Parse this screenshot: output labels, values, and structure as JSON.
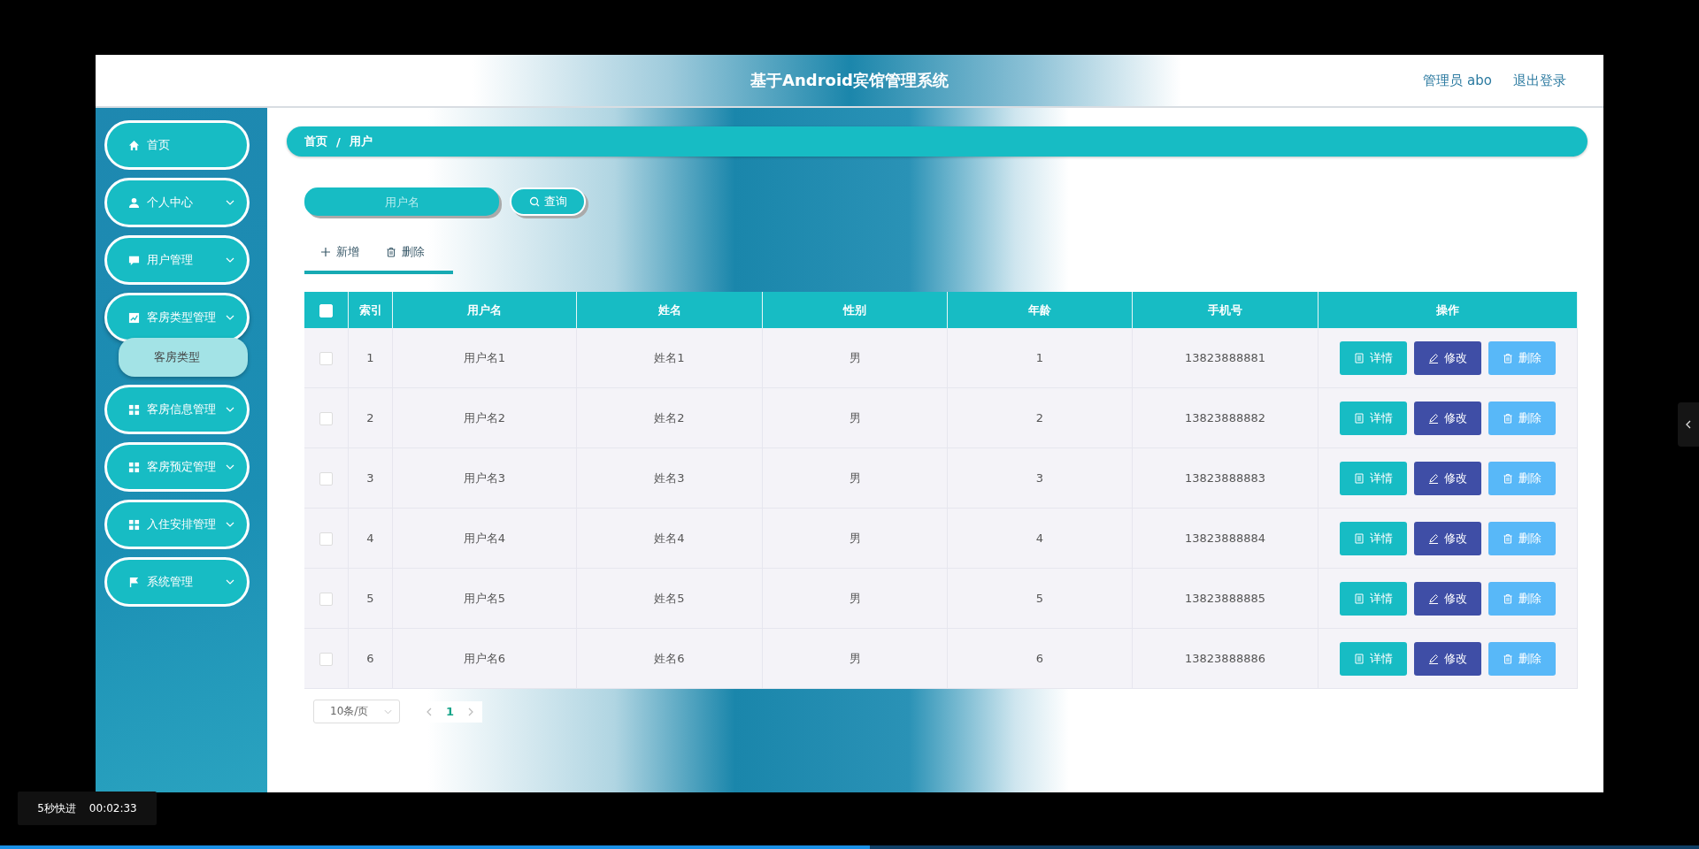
{
  "player": {
    "toast": {
      "label": "5秒快进",
      "time": "00:02:33"
    },
    "progress": {
      "level": 0.512
    }
  },
  "header": {
    "title": "基于Android宾馆管理系统",
    "user": "管理员 abo",
    "logout": "退出登录"
  },
  "sidebar": {
    "items": [
      {
        "label": "首页",
        "kind": "home",
        "has_submenu": false,
        "expanded": false
      },
      {
        "label": "个人中心",
        "kind": "user",
        "has_submenu": true,
        "expanded": false
      },
      {
        "label": "用户管理",
        "kind": "chat",
        "has_submenu": true,
        "expanded": false
      },
      {
        "label": "客房类型管理",
        "kind": "chart",
        "has_submenu": true,
        "expanded": true,
        "children": [
          {
            "label": "客房类型"
          }
        ]
      },
      {
        "label": "客房信息管理",
        "kind": "grid",
        "has_submenu": true,
        "expanded": false
      },
      {
        "label": "客房预定管理",
        "kind": "grid",
        "has_submenu": true,
        "expanded": false
      },
      {
        "label": "入住安排管理",
        "kind": "grid",
        "has_submenu": true,
        "expanded": false
      },
      {
        "label": "系统管理",
        "kind": "flag",
        "has_submenu": true,
        "expanded": false
      }
    ]
  },
  "breadcrumb": {
    "items": [
      "首页",
      "用户"
    ],
    "separator": "/"
  },
  "search": {
    "placeholder": "用户名",
    "button": "查询"
  },
  "toolbar": [
    {
      "kind": "add",
      "label": "新增"
    },
    {
      "kind": "delete",
      "label": "删除"
    }
  ],
  "table": {
    "select_all": {
      "checked": false
    },
    "columns": [
      "索引",
      "用户名",
      "姓名",
      "性别",
      "年龄",
      "手机号",
      "操作"
    ],
    "rows": [
      {
        "checked": false,
        "cells": [
          "1",
          "用户名1",
          "姓名1",
          "男",
          "1",
          "13823888881"
        ],
        "actions": [
          {
            "kind": "detail",
            "label": "详情"
          },
          {
            "kind": "edit",
            "label": "修改"
          },
          {
            "kind": "delete",
            "label": "删除"
          }
        ]
      },
      {
        "checked": false,
        "cells": [
          "2",
          "用户名2",
          "姓名2",
          "男",
          "2",
          "13823888882"
        ],
        "actions": [
          {
            "kind": "detail",
            "label": "详情"
          },
          {
            "kind": "edit",
            "label": "修改"
          },
          {
            "kind": "delete",
            "label": "删除"
          }
        ]
      },
      {
        "checked": false,
        "cells": [
          "3",
          "用户名3",
          "姓名3",
          "男",
          "3",
          "13823888883"
        ],
        "actions": [
          {
            "kind": "detail",
            "label": "详情"
          },
          {
            "kind": "edit",
            "label": "修改"
          },
          {
            "kind": "delete",
            "label": "删除"
          }
        ]
      },
      {
        "checked": false,
        "cells": [
          "4",
          "用户名4",
          "姓名4",
          "男",
          "4",
          "13823888884"
        ],
        "actions": [
          {
            "kind": "detail",
            "label": "详情"
          },
          {
            "kind": "edit",
            "label": "修改"
          },
          {
            "kind": "delete",
            "label": "删除"
          }
        ]
      },
      {
        "checked": false,
        "cells": [
          "5",
          "用户名5",
          "姓名5",
          "男",
          "5",
          "13823888885"
        ],
        "actions": [
          {
            "kind": "detail",
            "label": "详情"
          },
          {
            "kind": "edit",
            "label": "修改"
          },
          {
            "kind": "delete",
            "label": "删除"
          }
        ]
      },
      {
        "checked": false,
        "cells": [
          "6",
          "用户名6",
          "姓名6",
          "男",
          "6",
          "13823888886"
        ],
        "actions": [
          {
            "kind": "detail",
            "label": "详情"
          },
          {
            "kind": "edit",
            "label": "修改"
          },
          {
            "kind": "delete",
            "label": "删除"
          }
        ]
      }
    ]
  },
  "pagination": {
    "page_size": "10条/页",
    "pages": [
      {
        "label": "1",
        "selected": true
      }
    ]
  }
}
